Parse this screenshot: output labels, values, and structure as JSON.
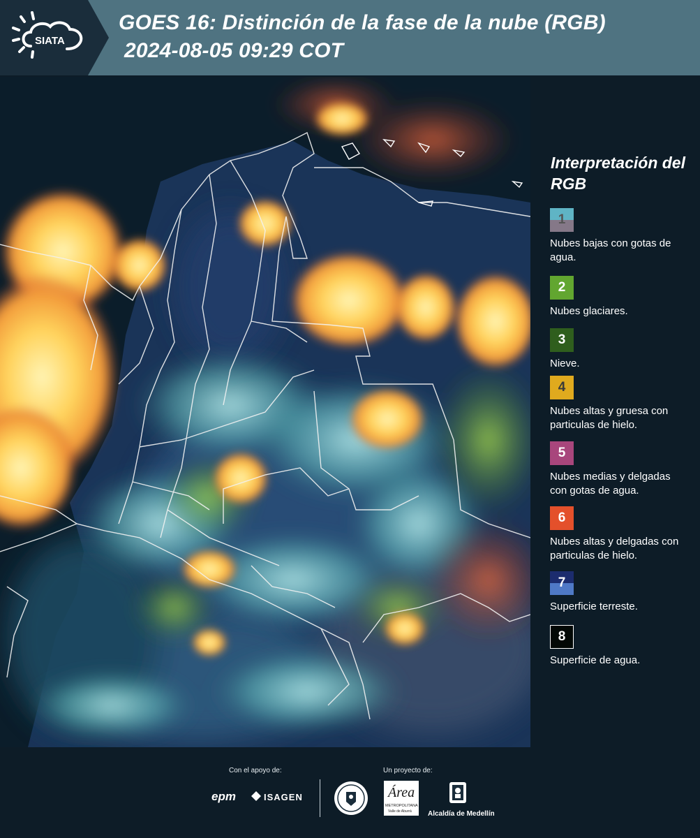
{
  "header": {
    "logo_text": "SIATA",
    "title_line1": "GOES 16: Distinción de la fase de la nube (RGB)",
    "title_line2": "2024-08-05 09:29 COT"
  },
  "legend": {
    "title": "Interpretación del RGB",
    "items": [
      {
        "number": "1",
        "label": "Nubes bajas con gotas de agua.",
        "color_top": "#5fb4c5",
        "color_bottom": "#857888"
      },
      {
        "number": "2",
        "label": "Nubes glaciares.",
        "color_top": "#62a630",
        "color_bottom": "#62a630"
      },
      {
        "number": "3",
        "label": "Nieve.",
        "color_top": "#2f5e1d",
        "color_bottom": "#2f5e1d"
      },
      {
        "number": "4",
        "label": "Nubes altas y gruesa con particulas de hielo.",
        "color_top": "#e0aa1e",
        "color_bottom": "#e0aa1e"
      },
      {
        "number": "5",
        "label": "Nubes medias y delgadas con gotas de agua.",
        "color_top": "#a8467c",
        "color_bottom": "#a8467c"
      },
      {
        "number": "6",
        "label": "Nubes altas y delgadas con particulas de hielo.",
        "color_top": "#e4502b",
        "color_bottom": "#e4502b"
      },
      {
        "number": "7",
        "label": "Superficie terreste.",
        "color_top": "#1c2c6e",
        "color_bottom": "#4f79c6"
      },
      {
        "number": "8",
        "label": "Superficie de agua.",
        "color_top": "#030805",
        "color_bottom": "#030805"
      }
    ]
  },
  "footer": {
    "support_label": "Con el apoyo de:",
    "project_label": "Un proyecto de:",
    "sponsor_epm": "epm",
    "sponsor_isagen": "ISAGEN",
    "sponsor_area": "Área",
    "sponsor_area_sub": "METROPOLITANA",
    "sponsor_area_sub2": "Valle de Aburrá",
    "sponsor_alcaldia": "Alcaldía de Medellín"
  }
}
